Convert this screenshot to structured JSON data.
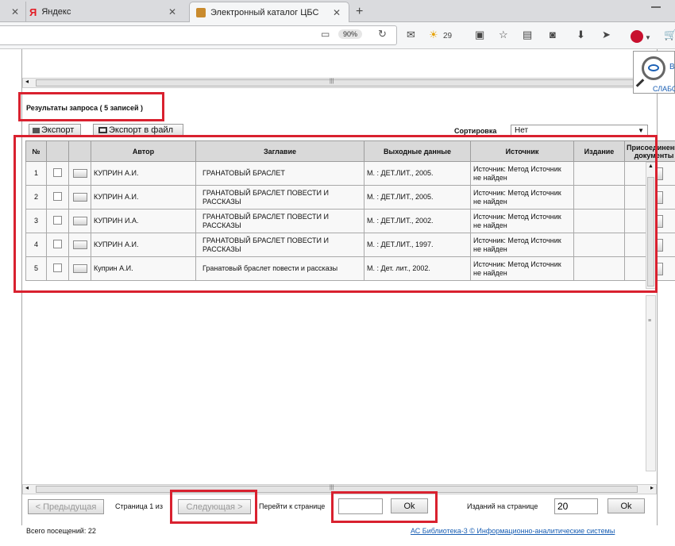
{
  "browser": {
    "tabs": [
      {
        "label": "Яндекс",
        "icon": "yandex-logo-icon"
      },
      {
        "label": "Электронный каталог ЦБС",
        "icon": "catalog-favicon-icon"
      }
    ],
    "new_tab": "+",
    "zoom": "90%",
    "weather": "29"
  },
  "results": {
    "title": "Результаты запроса ( 5 записей )",
    "export_label": "Экспорт",
    "export_file_label": "Экспорт в файл",
    "sort_label": "Сортировка",
    "sort_value": "Нет"
  },
  "table": {
    "headers": [
      "№",
      "Автор",
      "Заглавие",
      "Выходные данные",
      "Источник",
      "Издание",
      "Присоединенные документы"
    ],
    "rows": [
      {
        "num": "1",
        "author": "КУПРИН А.И.",
        "title": "ГРАНАТОВЫЙ БРАСЛЕТ",
        "output": "М. : ДЕТ.ЛИТ., 2005.",
        "source": "Источник: Метод Источник не найден"
      },
      {
        "num": "2",
        "author": "КУПРИН А.И.",
        "title": "ГРАНАТОВЫЙ БРАСЛЕТ ПОВЕСТИ И РАССКАЗЫ",
        "output": "М. : ДЕТ.ЛИТ., 2005.",
        "source": "Источник: Метод Источник не найден"
      },
      {
        "num": "3",
        "author": "КУПРИН И.А.",
        "title": "ГРАНАТОВЫЙ БРАСЛЕТ ПОВЕСТИ И РАССКАЗЫ",
        "output": "М. : ДЕТ.ЛИТ., 2002.",
        "source": "Источник: Метод Источник не найден"
      },
      {
        "num": "4",
        "author": "КУПРИН А.И.",
        "title": "ГРАНАТОВЫЙ БРАСЛЕТ ПОВЕСТИ И РАССКАЗЫ",
        "output": "М. : ДЕТ.ЛИТ., 1997.",
        "source": "Источник: Метод Источник не найден"
      },
      {
        "num": "5",
        "author": "Куприн А.И.",
        "title": "Гранатовый браслет повести и рассказы",
        "output": "М. : Дет. лит., 2002.",
        "source": "Источник: Метод Источник не найден"
      }
    ]
  },
  "pagination": {
    "prev": "< Предыдущая",
    "page_info": "Страница 1 из",
    "next": "Следующая >",
    "goto_label": "Перейти к странице",
    "goto_value": "",
    "ok": "Ok",
    "per_page_label": "Изданий на странице",
    "per_page_value": "20",
    "ok2": "Ok"
  },
  "footer": {
    "visits": "Всего посещений: 22",
    "credit": "АС Библиотека-3 © Информационно-аналитические системы"
  },
  "accessibility": {
    "label_top": "В",
    "label_bottom": "СЛАБО"
  },
  "colors": {
    "highlight": "#d9212f",
    "link": "#1a5fb4"
  }
}
